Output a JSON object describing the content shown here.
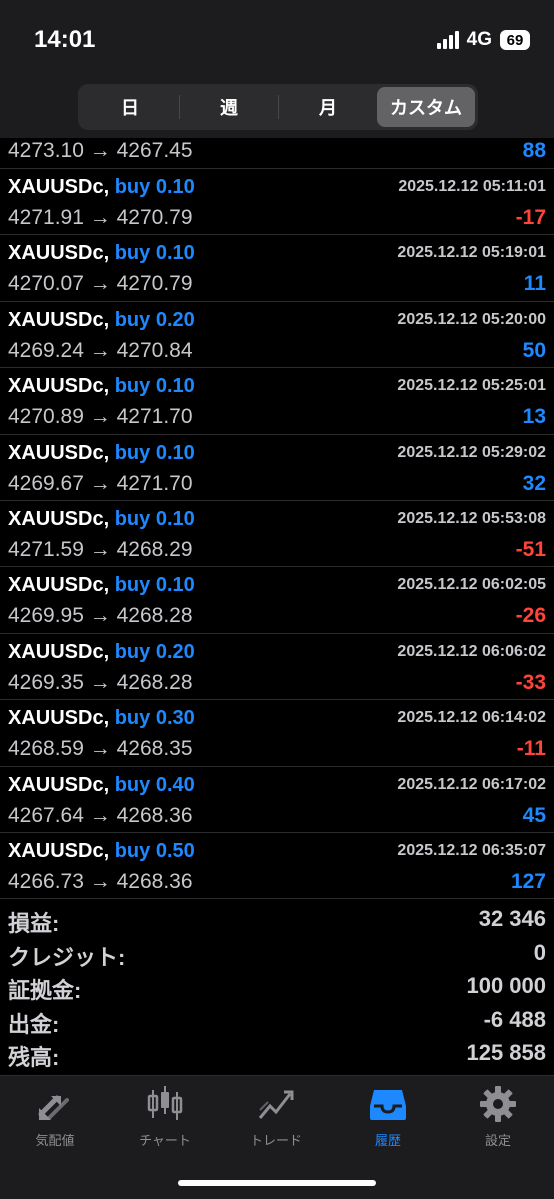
{
  "status_bar": {
    "time": "14:01",
    "network": "4G",
    "battery": "69"
  },
  "period_tabs": [
    {
      "label": "日",
      "active": false
    },
    {
      "label": "週",
      "active": false
    },
    {
      "label": "月",
      "active": false
    },
    {
      "label": "カスタム",
      "active": true
    }
  ],
  "first_row": {
    "open_price": "4273.10",
    "close_price": "4267.45",
    "profit": "88"
  },
  "arrow": "→",
  "trades": [
    {
      "symbol": "XAUUSDc,",
      "side": "buy 0.10",
      "time": "2025.12.12 05:11:01",
      "open_price": "4271.91",
      "close_price": "4270.79",
      "profit": "-17"
    },
    {
      "symbol": "XAUUSDc,",
      "side": "buy 0.10",
      "time": "2025.12.12 05:19:01",
      "open_price": "4270.07",
      "close_price": "4270.79",
      "profit": "11"
    },
    {
      "symbol": "XAUUSDc,",
      "side": "buy 0.20",
      "time": "2025.12.12 05:20:00",
      "open_price": "4269.24",
      "close_price": "4270.84",
      "profit": "50"
    },
    {
      "symbol": "XAUUSDc,",
      "side": "buy 0.10",
      "time": "2025.12.12 05:25:01",
      "open_price": "4270.89",
      "close_price": "4271.70",
      "profit": "13"
    },
    {
      "symbol": "XAUUSDc,",
      "side": "buy 0.10",
      "time": "2025.12.12 05:29:02",
      "open_price": "4269.67",
      "close_price": "4271.70",
      "profit": "32"
    },
    {
      "symbol": "XAUUSDc,",
      "side": "buy 0.10",
      "time": "2025.12.12 05:53:08",
      "open_price": "4271.59",
      "close_price": "4268.29",
      "profit": "-51"
    },
    {
      "symbol": "XAUUSDc,",
      "side": "buy 0.10",
      "time": "2025.12.12 06:02:05",
      "open_price": "4269.95",
      "close_price": "4268.28",
      "profit": "-26"
    },
    {
      "symbol": "XAUUSDc,",
      "side": "buy 0.20",
      "time": "2025.12.12 06:06:02",
      "open_price": "4269.35",
      "close_price": "4268.28",
      "profit": "-33"
    },
    {
      "symbol": "XAUUSDc,",
      "side": "buy 0.30",
      "time": "2025.12.12 06:14:02",
      "open_price": "4268.59",
      "close_price": "4268.35",
      "profit": "-11"
    },
    {
      "symbol": "XAUUSDc,",
      "side": "buy 0.40",
      "time": "2025.12.12 06:17:02",
      "open_price": "4267.64",
      "close_price": "4268.36",
      "profit": "45"
    },
    {
      "symbol": "XAUUSDc,",
      "side": "buy 0.50",
      "time": "2025.12.12 06:35:07",
      "open_price": "4266.73",
      "close_price": "4268.36",
      "profit": "127"
    }
  ],
  "summary": [
    {
      "label": "損益:",
      "value": "32 346"
    },
    {
      "label": "クレジット:",
      "value": "0"
    },
    {
      "label": "証拠金:",
      "value": "100 000"
    },
    {
      "label": "出金:",
      "value": "-6 488"
    },
    {
      "label": "残高:",
      "value": "125 858"
    }
  ],
  "tab_bar": [
    {
      "label": "気配値",
      "icon": "quotes-arrows-icon",
      "active": false
    },
    {
      "label": "チャート",
      "icon": "candlestick-icon",
      "active": false
    },
    {
      "label": "トレード",
      "icon": "trade-chart-icon",
      "active": false
    },
    {
      "label": "履歴",
      "icon": "history-inbox-icon",
      "active": true
    },
    {
      "label": "設定",
      "icon": "gear-icon",
      "active": false
    }
  ],
  "colors": {
    "accent_blue": "#1e88ff",
    "loss_red": "#ff453a",
    "background": "#000000",
    "bar_background": "#1c1c1e"
  }
}
